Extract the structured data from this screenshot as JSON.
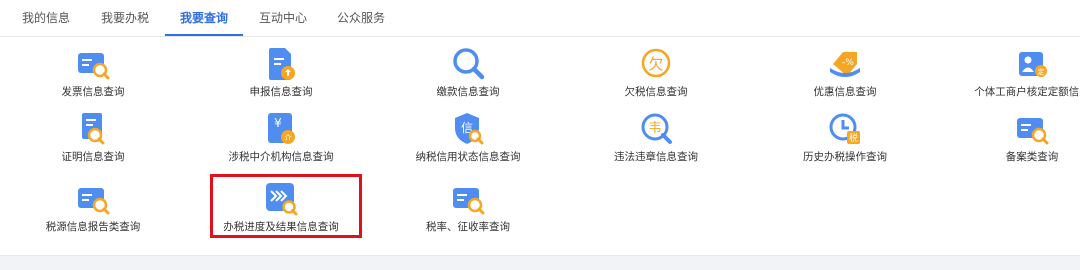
{
  "tabs": [
    {
      "label": "我的信息"
    },
    {
      "label": "我要办税"
    },
    {
      "label": "我要查询"
    },
    {
      "label": "互动中心"
    },
    {
      "label": "公众服务"
    }
  ],
  "active_tab": "我要查询",
  "accent_color": "#2f6fe0",
  "highlight_color": "#e0101c",
  "items": [
    {
      "label": "发票信息查询",
      "icon": "invoice-search-icon"
    },
    {
      "label": "申报信息查询",
      "icon": "declaration-upload-icon"
    },
    {
      "label": "缴款信息查询",
      "icon": "magnifier-icon"
    },
    {
      "label": "欠税信息查询",
      "icon": "tax-owed-icon"
    },
    {
      "label": "优惠信息查询",
      "icon": "discount-tag-icon"
    },
    {
      "label": "个体工商户核定定额信息",
      "icon": "fixed-quota-icon"
    },
    {
      "label": "证明信息查询",
      "icon": "certificate-search-icon"
    },
    {
      "label": "涉税中介机构信息查询",
      "icon": "agency-icon"
    },
    {
      "label": "纳税信用状态信息查询",
      "icon": "credit-shield-icon"
    },
    {
      "label": "违法违章信息查询",
      "icon": "violation-search-icon"
    },
    {
      "label": "历史办税操作查询",
      "icon": "history-clock-icon"
    },
    {
      "label": "备案类查询",
      "icon": "filing-search-icon"
    },
    {
      "label": "税源信息报告类查询",
      "icon": "tax-source-search-icon"
    },
    {
      "label": "办税进度及结果信息查询",
      "icon": "progress-search-icon"
    },
    {
      "label": "税率、征收率查询",
      "icon": "tax-rate-search-icon"
    }
  ]
}
